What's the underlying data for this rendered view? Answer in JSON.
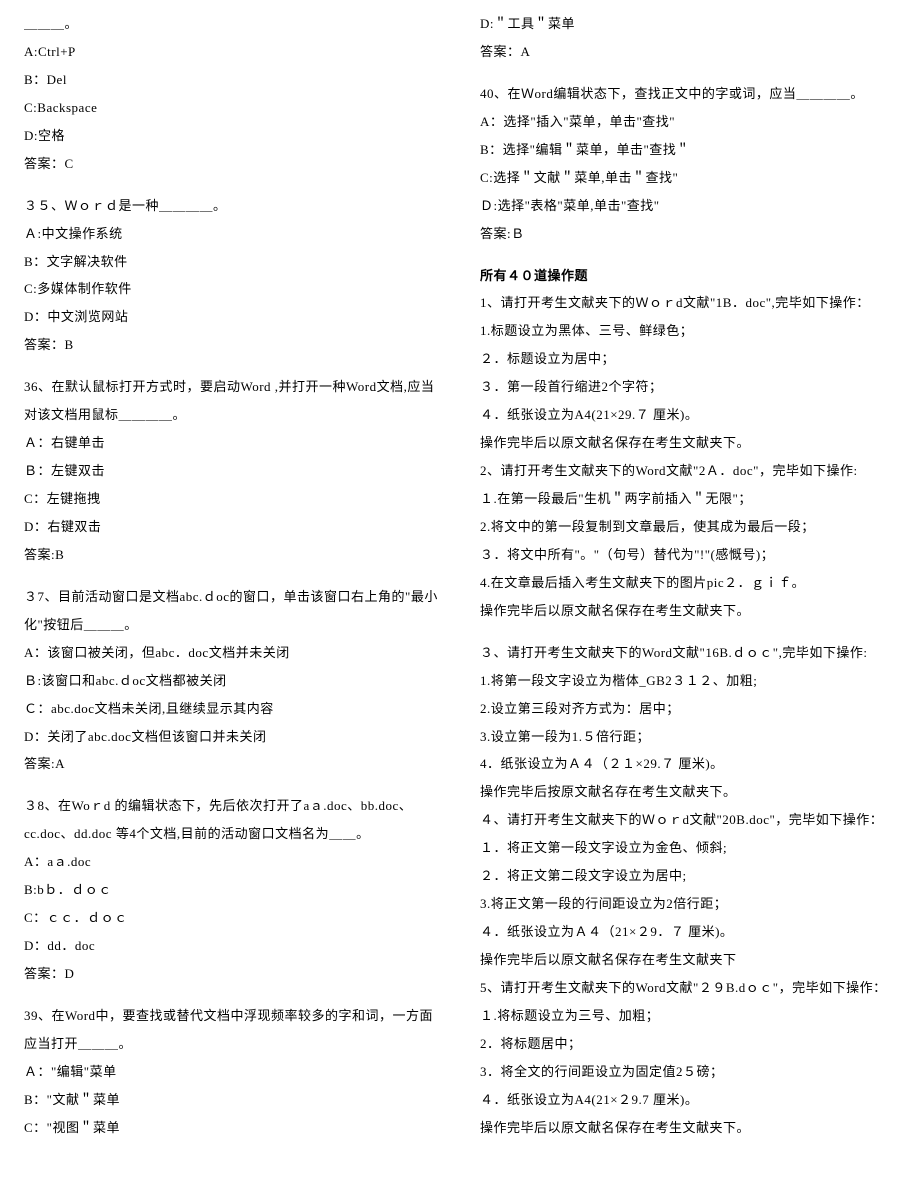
{
  "left": [
    "＿＿＿。",
    "A:Ctrl+P",
    "B：Del",
    "C:Backspace",
    "D:空格",
    "答案：C",
    "",
    "３５、Ｗｏｒｄ是一种＿＿＿＿。",
    "Ａ:中文操作系统",
    "B：文字解决软件",
    "C:多媒体制作软件",
    "D：中文浏览网站",
    "答案：B",
    "",
    "36、在默认鼠标打开方式时，要启动Word ,并打开一种Word文档,应当对该文档用鼠标＿＿＿＿。",
    "Ａ：右键单击",
    "Ｂ：左键双击",
    "C：左键拖拽",
    "D：右键双击",
    "答案:B",
    "",
    "３7、目前活动窗口是文档abc.ｄoc的窗口，单击该窗口右上角的\"最小化\"按钮后＿＿＿。",
    "A：该窗口被关闭，但abc．doc文档并未关闭",
    "Ｂ:该窗口和abc.ｄoc文档都被关闭",
    "Ｃ：abc.doc文档未关闭,且继续显示其内容",
    "D：关闭了abc.doc文档但该窗口并未关闭",
    "答案:A",
    "",
    "３8、在Woｒd 的编辑状态下，先后依次打开了aａ.doc、bb.doc、cc.doc、dd.doc 等4个文档,目前的活动窗口文档名为＿＿。",
    "A：aａ.doc",
    "B:bｂ．ｄｏｃ",
    "C：ｃｃ．ｄｏｃ",
    "D：dd．doc",
    "答案：D",
    "",
    "39、在Word中，要查找或替代文档中浮现频率较多的字和词，一方面应当打开＿＿＿。",
    "Ａ：\"编辑\"菜单",
    "B：\"文献＂菜单",
    "C：\"视图＂菜单"
  ],
  "right": [
    "D:＂工具＂菜单",
    "答案：A",
    "",
    "40、在Ｗord编辑状态下，查找正文中的字或词，应当＿＿＿＿。",
    "A：选择\"插入\"菜单，单击\"查找\"",
    "B：选择\"编辑＂菜单，单击\"查找＂",
    "C:选择＂文献＂菜单,单击＂查找\"",
    "Ｄ:选择\"表格\"菜单,单击\"查找\"",
    "答案:Ｂ",
    "",
    {
      "text": "所有４０道操作题",
      "bold": true
    },
    "1、请打开考生文献夹下的Ｗｏｒd文献\"1B．doc\",完毕如下操作：",
    "1.标题设立为黑体、三号、鲜绿色；",
    "２．标题设立为居中；",
    "３．第一段首行缩进2个字符；",
    "４．纸张设立为A4(21×29.７ 厘米)。",
    "操作完毕后以原文献名保存在考生文献夹下。",
    "2、请打开考生文献夹下的Word文献\"2Ａ．doc\"，完毕如下操作:",
    "１.在第一段最后\"生机＂两字前插入＂无限\"；",
    "2.将文中的第一段复制到文章最后，使其成为最后一段；",
    "３．将文中所有\"。\"（句号）替代为\"!\"(感慨号)；",
    "4.在文章最后插入考生文献夹下的图片pic２．ｇｉｆ。",
    "操作完毕后以原文献名保存在考生文献夹下。",
    "",
    "３、请打开考生文献夹下的Word文献\"16B.ｄｏｃ\",完毕如下操作:",
    "1.将第一段文字设立为楷体_GB2３１２、加粗;",
    "2.设立第三段对齐方式为：居中；",
    "3.设立第一段为1.５倍行距；",
    "4．纸张设立为Ａ４（２１×29.７ 厘米)。",
    "操作完毕后按原文献名存在考生文献夹下。",
    "４、请打开考生文献夹下的Ｗｏｒd文献\"20B.doc\"，完毕如下操作：",
    "１．将正文第一段文字设立为金色、倾斜;",
    "２．将正文第二段文字设立为居中;",
    "3.将正文第一段的行间距设立为2倍行距；",
    "４．纸张设立为Ａ４（21×２9．７ 厘米)。",
    "操作完毕后以原文献名保存在考生文献夹下",
    "5、请打开考生文献夹下的Word文献\"２９B.dｏｃ\"，完毕如下操作：",
    "１.将标题设立为三号、加粗；",
    "2．将标题居中；",
    "3．将全文的行间距设立为固定值2５磅；",
    "４．纸张设立为A4(21×２9.7 厘米)。",
    "操作完毕后以原文献名保存在考生文献夹下。"
  ]
}
